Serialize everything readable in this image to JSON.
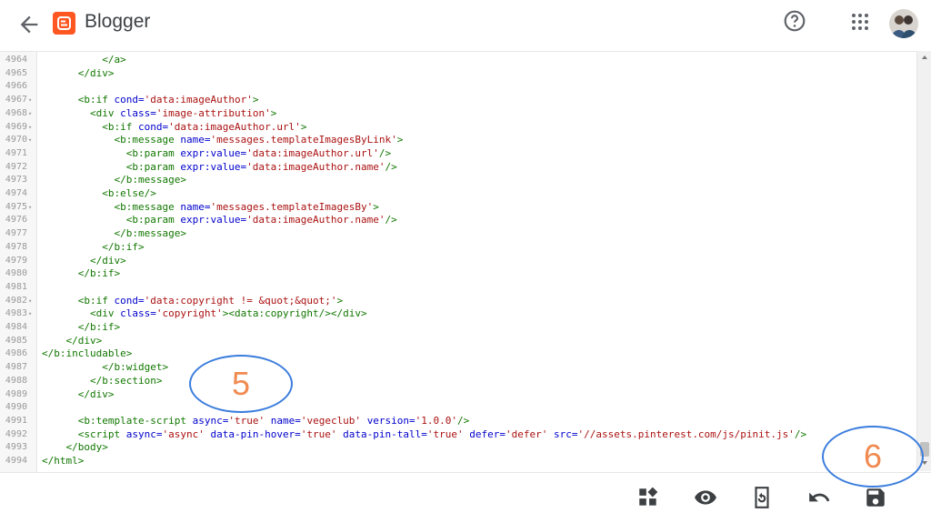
{
  "app": {
    "title": "Blogger"
  },
  "icons": {
    "back": "back-arrow-icon",
    "logo": "blogger-logo-icon",
    "help": "help-icon",
    "apps": "apps-grid-icon",
    "avatar": "user-avatar"
  },
  "code_lines": [
    {
      "num": "4964",
      "fold": "",
      "segs": [
        {
          "t": "          ",
          "c": "plain"
        },
        {
          "t": "</a>",
          "c": "tag"
        }
      ]
    },
    {
      "num": "4965",
      "fold": "",
      "segs": [
        {
          "t": "      ",
          "c": "plain"
        },
        {
          "t": "</div>",
          "c": "tag"
        }
      ]
    },
    {
      "num": "4966",
      "fold": "",
      "segs": []
    },
    {
      "num": "4967",
      "fold": "▾",
      "segs": [
        {
          "t": "      ",
          "c": "plain"
        },
        {
          "t": "<b:if ",
          "c": "tag"
        },
        {
          "t": "cond=",
          "c": "attr"
        },
        {
          "t": "'data:imageAuthor'",
          "c": "str"
        },
        {
          "t": ">",
          "c": "tag"
        }
      ]
    },
    {
      "num": "4968",
      "fold": "▾",
      "segs": [
        {
          "t": "        ",
          "c": "plain"
        },
        {
          "t": "<div ",
          "c": "tag"
        },
        {
          "t": "class=",
          "c": "attr"
        },
        {
          "t": "'image-attribution'",
          "c": "str"
        },
        {
          "t": ">",
          "c": "tag"
        }
      ]
    },
    {
      "num": "4969",
      "fold": "▾",
      "segs": [
        {
          "t": "          ",
          "c": "plain"
        },
        {
          "t": "<b:if ",
          "c": "tag"
        },
        {
          "t": "cond=",
          "c": "attr"
        },
        {
          "t": "'data:imageAuthor.url'",
          "c": "str"
        },
        {
          "t": ">",
          "c": "tag"
        }
      ]
    },
    {
      "num": "4970",
      "fold": "▾",
      "segs": [
        {
          "t": "            ",
          "c": "plain"
        },
        {
          "t": "<b:message ",
          "c": "tag"
        },
        {
          "t": "name=",
          "c": "attr"
        },
        {
          "t": "'messages.templateImagesByLink'",
          "c": "str"
        },
        {
          "t": ">",
          "c": "tag"
        }
      ]
    },
    {
      "num": "4971",
      "fold": "",
      "segs": [
        {
          "t": "              ",
          "c": "plain"
        },
        {
          "t": "<b:param ",
          "c": "tag"
        },
        {
          "t": "expr:value=",
          "c": "attr"
        },
        {
          "t": "'data:imageAuthor.url'",
          "c": "str"
        },
        {
          "t": "/>",
          "c": "tag"
        }
      ]
    },
    {
      "num": "4972",
      "fold": "",
      "segs": [
        {
          "t": "              ",
          "c": "plain"
        },
        {
          "t": "<b:param ",
          "c": "tag"
        },
        {
          "t": "expr:value=",
          "c": "attr"
        },
        {
          "t": "'data:imageAuthor.name'",
          "c": "str"
        },
        {
          "t": "/>",
          "c": "tag"
        }
      ]
    },
    {
      "num": "4973",
      "fold": "",
      "segs": [
        {
          "t": "            ",
          "c": "plain"
        },
        {
          "t": "</b:message>",
          "c": "tag"
        }
      ]
    },
    {
      "num": "4974",
      "fold": "",
      "segs": [
        {
          "t": "          ",
          "c": "plain"
        },
        {
          "t": "<b:else/>",
          "c": "tag"
        }
      ]
    },
    {
      "num": "4975",
      "fold": "▾",
      "segs": [
        {
          "t": "            ",
          "c": "plain"
        },
        {
          "t": "<b:message ",
          "c": "tag"
        },
        {
          "t": "name=",
          "c": "attr"
        },
        {
          "t": "'messages.templateImagesBy'",
          "c": "str"
        },
        {
          "t": ">",
          "c": "tag"
        }
      ]
    },
    {
      "num": "4976",
      "fold": "",
      "segs": [
        {
          "t": "              ",
          "c": "plain"
        },
        {
          "t": "<b:param ",
          "c": "tag"
        },
        {
          "t": "expr:value=",
          "c": "attr"
        },
        {
          "t": "'data:imageAuthor.name'",
          "c": "str"
        },
        {
          "t": "/>",
          "c": "tag"
        }
      ]
    },
    {
      "num": "4977",
      "fold": "",
      "segs": [
        {
          "t": "            ",
          "c": "plain"
        },
        {
          "t": "</b:message>",
          "c": "tag"
        }
      ]
    },
    {
      "num": "4978",
      "fold": "",
      "segs": [
        {
          "t": "          ",
          "c": "plain"
        },
        {
          "t": "</b:if>",
          "c": "tag"
        }
      ]
    },
    {
      "num": "4979",
      "fold": "",
      "segs": [
        {
          "t": "        ",
          "c": "plain"
        },
        {
          "t": "</div>",
          "c": "tag"
        }
      ]
    },
    {
      "num": "4980",
      "fold": "",
      "segs": [
        {
          "t": "      ",
          "c": "plain"
        },
        {
          "t": "</b:if>",
          "c": "tag"
        }
      ]
    },
    {
      "num": "4981",
      "fold": "",
      "segs": []
    },
    {
      "num": "4982",
      "fold": "▾",
      "segs": [
        {
          "t": "      ",
          "c": "plain"
        },
        {
          "t": "<b:if ",
          "c": "tag"
        },
        {
          "t": "cond=",
          "c": "attr"
        },
        {
          "t": "'data:copyright != &quot;&quot;'",
          "c": "str"
        },
        {
          "t": ">",
          "c": "tag"
        }
      ]
    },
    {
      "num": "4983",
      "fold": "▾",
      "segs": [
        {
          "t": "        ",
          "c": "plain"
        },
        {
          "t": "<div ",
          "c": "tag"
        },
        {
          "t": "class=",
          "c": "attr"
        },
        {
          "t": "'copyright'",
          "c": "str"
        },
        {
          "t": "><data:copyright/></div>",
          "c": "tag"
        }
      ]
    },
    {
      "num": "4984",
      "fold": "",
      "segs": [
        {
          "t": "      ",
          "c": "plain"
        },
        {
          "t": "</b:if>",
          "c": "tag"
        }
      ]
    },
    {
      "num": "4985",
      "fold": "",
      "segs": [
        {
          "t": "    ",
          "c": "plain"
        },
        {
          "t": "</div>",
          "c": "tag"
        }
      ]
    },
    {
      "num": "4986",
      "fold": "",
      "segs": [
        {
          "t": "</b:includable>",
          "c": "tag"
        }
      ]
    },
    {
      "num": "4987",
      "fold": "",
      "segs": [
        {
          "t": "          ",
          "c": "plain"
        },
        {
          "t": "</b:widget>",
          "c": "tag"
        }
      ]
    },
    {
      "num": "4988",
      "fold": "",
      "segs": [
        {
          "t": "        ",
          "c": "plain"
        },
        {
          "t": "</b:section>",
          "c": "tag"
        }
      ]
    },
    {
      "num": "4989",
      "fold": "",
      "segs": [
        {
          "t": "      ",
          "c": "plain"
        },
        {
          "t": "</div>",
          "c": "tag"
        }
      ]
    },
    {
      "num": "4990",
      "fold": "",
      "segs": []
    },
    {
      "num": "4991",
      "fold": "",
      "segs": [
        {
          "t": "      ",
          "c": "plain"
        },
        {
          "t": "<b:template-script ",
          "c": "tag"
        },
        {
          "t": "async=",
          "c": "attr"
        },
        {
          "t": "'true' ",
          "c": "str"
        },
        {
          "t": "name=",
          "c": "attr"
        },
        {
          "t": "'vegeclub' ",
          "c": "str"
        },
        {
          "t": "version=",
          "c": "attr"
        },
        {
          "t": "'1.0.0'",
          "c": "str"
        },
        {
          "t": "/>",
          "c": "tag"
        }
      ]
    },
    {
      "num": "4992",
      "fold": "",
      "segs": [
        {
          "t": "      ",
          "c": "plain"
        },
        {
          "t": "<script ",
          "c": "tag"
        },
        {
          "t": "async=",
          "c": "attr"
        },
        {
          "t": "'async' ",
          "c": "str"
        },
        {
          "t": "data-pin-hover=",
          "c": "attr"
        },
        {
          "t": "'true' ",
          "c": "str"
        },
        {
          "t": "data-pin-tall=",
          "c": "attr"
        },
        {
          "t": "'true' ",
          "c": "str"
        },
        {
          "t": "defer=",
          "c": "attr"
        },
        {
          "t": "'defer' ",
          "c": "str"
        },
        {
          "t": "src=",
          "c": "attr"
        },
        {
          "t": "'//assets.pinterest.com/js/pinit.js'",
          "c": "str"
        },
        {
          "t": "/>",
          "c": "tag"
        }
      ]
    },
    {
      "num": "4993",
      "fold": "",
      "segs": [
        {
          "t": "    ",
          "c": "plain"
        },
        {
          "t": "</body>",
          "c": "tag"
        }
      ]
    },
    {
      "num": "4994",
      "fold": "",
      "segs": [
        {
          "t": "</html>",
          "c": "tag"
        }
      ]
    }
  ],
  "toolbar": {
    "items": [
      {
        "name": "layout-button",
        "icon": "widgets-icon"
      },
      {
        "name": "preview-button",
        "icon": "eye-icon"
      },
      {
        "name": "revert-button",
        "icon": "restore-icon"
      },
      {
        "name": "undo-button",
        "icon": "undo-icon"
      },
      {
        "name": "save-button",
        "icon": "save-icon"
      }
    ]
  },
  "annotations": {
    "five": "5",
    "six": "6"
  },
  "colors": {
    "accent": "#ff5722",
    "annotation_circle": "#3b7ddd",
    "annotation_number": "#f08a50"
  }
}
